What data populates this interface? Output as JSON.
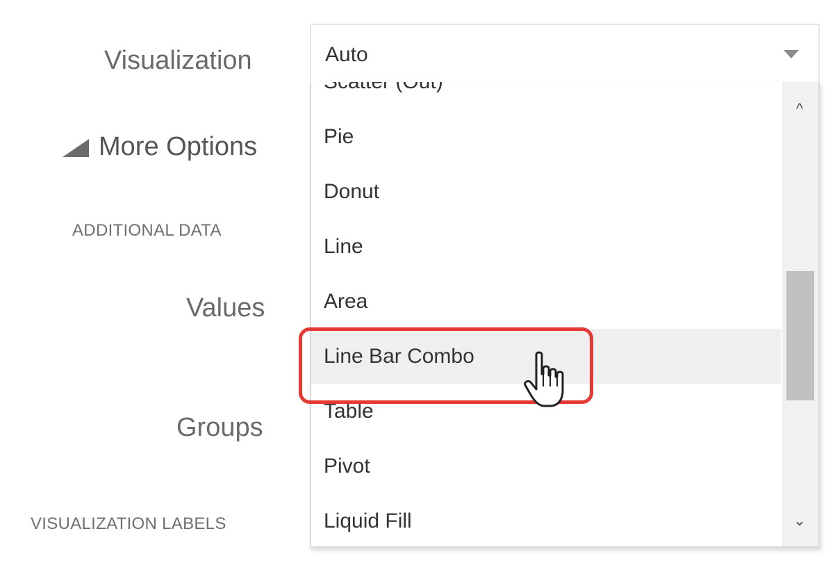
{
  "labels": {
    "visualization": "Visualization",
    "more_options": "More Options",
    "additional_data": "ADDITIONAL DATA",
    "values": "Values",
    "groups": "Groups",
    "visualization_labels": "VISUALIZATION LABELS"
  },
  "select": {
    "value": "Auto"
  },
  "dropdown": {
    "items": [
      "Scatter (Out)",
      "Pie",
      "Donut",
      "Line",
      "Area",
      "Line Bar Combo",
      "Table",
      "Pivot",
      "Liquid Fill"
    ],
    "hovered_item": "Line Bar Combo"
  },
  "icons": {
    "more_options_toggle": "triangle-expanded-icon",
    "select_caret": "chevron-down-icon",
    "scroll_up": "chevron-up-icon",
    "scroll_down": "chevron-down-icon",
    "cursor": "hand-pointer-icon"
  },
  "colors": {
    "highlight": "#e53935",
    "hover_bg": "#efefef",
    "label_text": "#6a6a6a"
  }
}
